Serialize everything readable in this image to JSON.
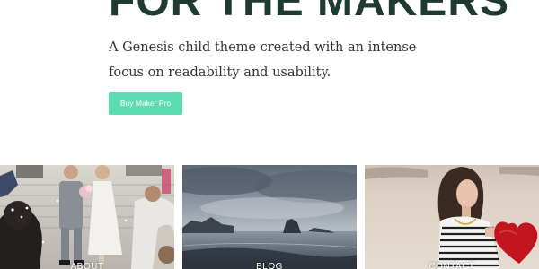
{
  "hero": {
    "title": "FOR THE MAKERS",
    "description": "A Genesis child theme created with an intense focus on readability and usability.",
    "cta_label": "Buy Maker Pro"
  },
  "tiles": [
    {
      "label": "ABOUT",
      "image": "wedding-couple-photo"
    },
    {
      "label": "BLOG",
      "image": "coastal-landscape-photo"
    },
    {
      "label": "CONTACT",
      "image": "woman-with-red-heart-photo"
    }
  ],
  "colors": {
    "title": "#1e3a33",
    "cta_background": "#5cdcb0",
    "body_text": "#333333"
  }
}
